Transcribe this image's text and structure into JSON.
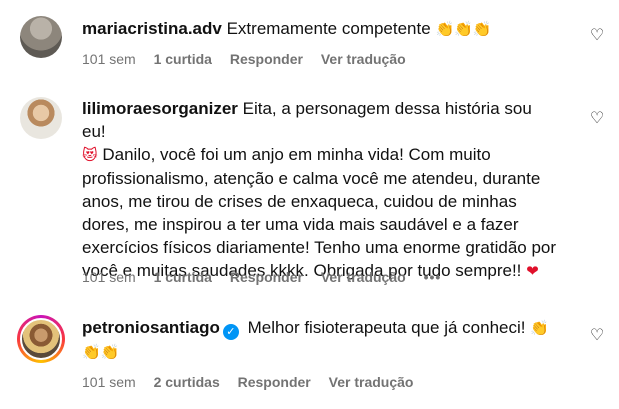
{
  "comments": [
    {
      "username": "mariacristina.adv",
      "text": "Extremamente competente",
      "emojis": "👏👏👏",
      "time": "101 sem",
      "likes": "1 curtida",
      "reply": "Responder",
      "translate": "Ver tradução",
      "like_icon": "♡"
    },
    {
      "username": "lilimoraesorganizer",
      "text_lead": "Eita, a personagem dessa história sou eu!",
      "emoji_face": "😻",
      "text_body": "Danilo, você foi um anjo em minha vida! Com muito profissionalismo, atenção e calma você me atendeu, durante anos, me tirou de crises de enxaqueca, cuidou de minhas dores, me inspirou a ter uma vida mais saudável e a fazer exercícios físicos diariamente! Tenho uma enorme gratidão por você e muitas saudades kkkk. Obrigada por tudo sempre!!",
      "emoji_heart": "❤",
      "time": "101 sem",
      "likes": "1 curtida",
      "reply": "Responder",
      "translate": "Ver tradução",
      "more": "•••",
      "like_icon": "♡"
    },
    {
      "username": "petroniosantiago",
      "verified_icon": "✓",
      "text": "Melhor fisioterapeuta que já conheci!",
      "emojis_1": "👏",
      "emojis_2": "👏👏",
      "time": "101 sem",
      "likes": "2 curtidas",
      "reply": "Responder",
      "translate": "Ver tradução",
      "like_icon": "♡"
    }
  ],
  "colors": {
    "meta_gray": "#737373",
    "verified_blue": "#0095f6",
    "heart_red": "#e0102b"
  }
}
